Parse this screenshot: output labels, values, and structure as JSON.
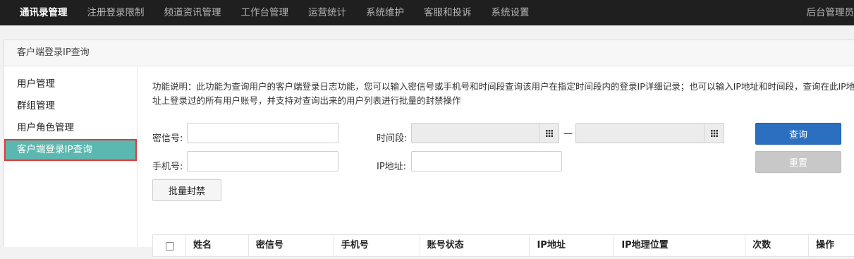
{
  "topnav": {
    "items": [
      {
        "label": "通讯录管理",
        "active": true
      },
      {
        "label": "注册登录限制"
      },
      {
        "label": "频道资讯管理"
      },
      {
        "label": "工作台管理"
      },
      {
        "label": "运营统计"
      },
      {
        "label": "系统维护"
      },
      {
        "label": "客服和投诉"
      },
      {
        "label": "系统设置"
      }
    ],
    "user_label": "后台管理员"
  },
  "panel": {
    "title": "客户端登录IP查询"
  },
  "sidebar": {
    "items": [
      {
        "label": "用户管理"
      },
      {
        "label": "群组管理"
      },
      {
        "label": "用户角色管理"
      },
      {
        "label": "客户端登录IP查询",
        "active": true
      }
    ]
  },
  "main": {
    "description": "功能说明：此功能为查询用户的客户端登录日志功能，您可以输入密信号或手机号和时间段查询该用户在指定时间段内的登录IP详细记录；也可以输入IP地址和时间段，查询在此IP地址上登录过的所有用户账号，并支持对查询出来的用户列表进行批量的封禁操作",
    "form": {
      "mixin_label": "密信号:",
      "mixin_value": "",
      "phone_label": "手机号:",
      "phone_value": "",
      "time_label": "时间段:",
      "time_start": "",
      "time_end": "",
      "time_separator": "—",
      "ip_label": "IP地址:",
      "ip_value": ""
    },
    "buttons": {
      "query": "查询",
      "reset": "重置",
      "batch_ban": "批量封禁"
    },
    "table": {
      "headers": [
        "姓名",
        "密信号",
        "手机号",
        "账号状态",
        "IP地址",
        "IP地理位置",
        "次数",
        "操作"
      ]
    }
  },
  "colors": {
    "topbar_bg": "#1f1f1f",
    "sidebar_active_bg": "#5bb8b0",
    "highlight_border": "#e03c3c",
    "primary_button": "#2a6fc0"
  },
  "icons": {
    "calendar": "calendar-grid-icon"
  }
}
